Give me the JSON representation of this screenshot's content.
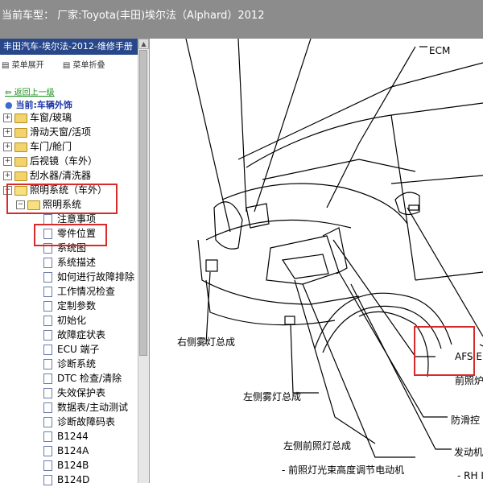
{
  "header": {
    "title": "当前车型： 厂家:Toyota(丰田)埃尔法（Alphard）2012"
  },
  "sidebar": {
    "tree_title": "丰田汽车-埃尔法-2012-维修手册",
    "expand_all": "菜单展开",
    "collapse_all": "菜单折叠",
    "back_link": "返回上一级",
    "current_label": "当前:车辆外饰",
    "folders": [
      {
        "label": "车窗/玻璃"
      },
      {
        "label": "滑动天窗/活项"
      },
      {
        "label": "车门/舱门"
      },
      {
        "label": "后视镜（车外）"
      },
      {
        "label": "刮水器/清洗器"
      },
      {
        "label": "照明系统（车外）"
      }
    ],
    "subfolder": "照明系统",
    "docs": [
      "注意事项",
      "零件位置",
      "系统图",
      "系统描述",
      "如何进行故障排除",
      "工作情况检查",
      "定制参数",
      "初始化",
      "故障症状表",
      "ECU 端子",
      "诊断系统",
      "DTC 检查/清除",
      "失效保护表",
      "数据表/主动测试",
      "诊断故障码表",
      "B1244",
      "B124A",
      "B124B",
      "B124D"
    ]
  },
  "diagram": {
    "labels": {
      "ecm": "ECM",
      "right_fog": "右侧雾灯总成",
      "left_fog": "左侧雾灯总成",
      "left_head": "左侧前照灯总成",
      "leveling_motor": "- 前照灯光束高度调节电动机",
      "afs": "AFS E",
      "headlamp_cut": "前照炉",
      "antiglare_cut": "防滑控",
      "engine_cut": "发动机",
      "rh_cut": "- RH I"
    }
  }
}
